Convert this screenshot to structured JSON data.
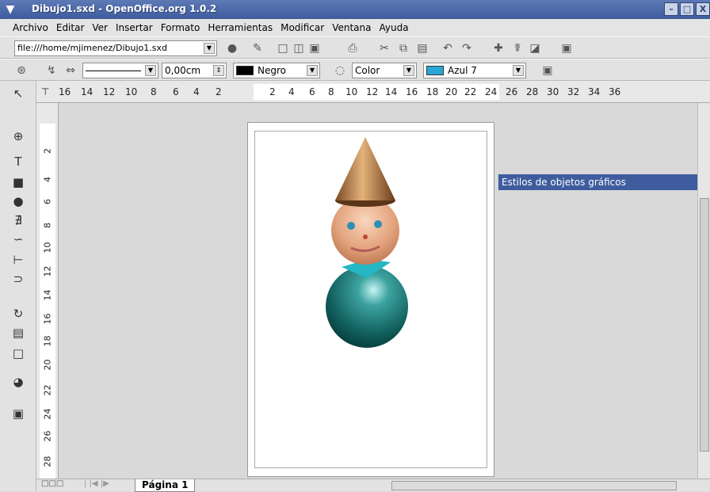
{
  "window": {
    "title": "Dibujo1.sxd - OpenOffice.org 1.0.2",
    "controls": [
      "–",
      "□",
      "X"
    ]
  },
  "menu": [
    "Archivo",
    "Editar",
    "Ver",
    "Insertar",
    "Formato",
    "Herramientas",
    "Modificar",
    "Ventana",
    "Ayuda"
  ],
  "toolbar": {
    "url": "file:///home/mjimenez/Dibujo1.sxd"
  },
  "format_bar": {
    "line_width": "0,00cm",
    "line_color": "Negro",
    "area_style": "Color",
    "area_color": "Azul 7",
    "colors": {
      "negro": "#000000",
      "azul7": "#29a6d8"
    }
  },
  "ruler": {
    "h_left": [
      "16",
      "14",
      "12",
      "10",
      "8",
      "6",
      "4",
      "2"
    ],
    "h_right": [
      "2",
      "4",
      "6",
      "8",
      "10",
      "12",
      "14",
      "16",
      "18",
      "20",
      "22",
      "24",
      "26",
      "28",
      "30",
      "32",
      "34",
      "36"
    ],
    "v": [
      "2",
      "4",
      "6",
      "8",
      "10",
      "12",
      "14",
      "16",
      "18",
      "20",
      "22",
      "24",
      "26",
      "28"
    ]
  },
  "stylist": {
    "title": "Estilos de objetos gráficos"
  },
  "tabs": {
    "page_label": "Página 1"
  },
  "figure": {
    "hat_color": "#c48a55",
    "head_color": "#e9b38f",
    "body_color": "#12615f",
    "collar_color": "#23b8c4"
  }
}
